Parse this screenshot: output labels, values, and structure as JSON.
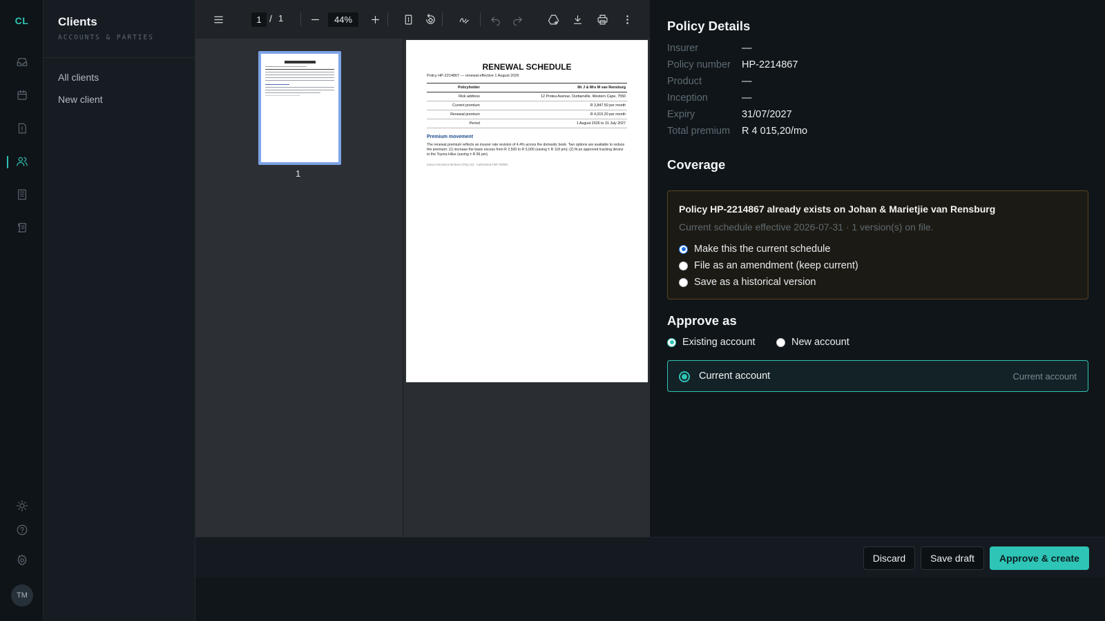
{
  "rail": {
    "logo": "CL",
    "icons": [
      "inbox-icon",
      "calendar-icon",
      "alert-doc-icon",
      "clients-icon",
      "building-icon",
      "ledger-icon"
    ],
    "bottom_icons": [
      "theme-icon",
      "help-icon",
      "settings-icon"
    ],
    "avatar": "TM",
    "accent": "#2ec4b6"
  },
  "subnav": {
    "title": "Clients",
    "subtitle": "ACCOUNTS & PARTIES",
    "items": [
      {
        "label": "All clients"
      },
      {
        "label": "New client"
      }
    ]
  },
  "viewer": {
    "current_page": "1",
    "page_separator": "/",
    "total_pages": "1",
    "zoom": "44%",
    "thumbnail_label": "1"
  },
  "document": {
    "title": "RENEWAL SCHEDULE",
    "subtitle": "Policy HP-2214867 — renewal effective 1 August 2026",
    "header_left": "Policyholder",
    "header_right": "Mr J & Mrs M van Rensburg",
    "rows": [
      {
        "label": "Risk address",
        "value": "12 Protea Avenue, Durbanville, Western Cape, 7550"
      },
      {
        "label": "Current premium",
        "value": "R 3,847.50 per month"
      },
      {
        "label": "Renewal premium",
        "value": "R 4,015.20 per month"
      },
      {
        "label": "Period",
        "value": "1 August 2026 to 31 July 2027"
      }
    ],
    "section_title": "Premium movement",
    "paragraph": "The renewal premium reflects an insurer rate revision of 4.4% across the domestic book. Two options are available to reduce the premium: (1) increase the basic excess from R 2,500 to R 5,000 (saving ± R 118 pm); (2) fit an approved tracking device to the Toyota Hilux (saving ± R 96 pm).",
    "footer": "Karoo Insurance Brokers (Pty) Ltd · Authorised FSP 00000"
  },
  "panel": {
    "policy_heading": "Policy Details",
    "details": [
      {
        "label": "Insurer",
        "value": "—"
      },
      {
        "label": "Policy number",
        "value": "HP-2214867"
      },
      {
        "label": "Product",
        "value": "—"
      },
      {
        "label": "Inception",
        "value": "—"
      },
      {
        "label": "Expiry",
        "value": "31/07/2027"
      },
      {
        "label": "Total premium",
        "value": "R 4 015,20/mo"
      }
    ],
    "coverage_heading": "Coverage",
    "conflict": {
      "title": "Policy HP-2214867 already exists on Johan & Marietjie van Rensburg",
      "subtitle": "Current schedule effective 2026-07-31 · 1 version(s) on file.",
      "options": [
        {
          "label": "Make this the current schedule",
          "selected": true
        },
        {
          "label": "File as an amendment (keep current)",
          "selected": false
        },
        {
          "label": "Save as a historical version",
          "selected": false
        }
      ],
      "border_color": "#5a4422"
    },
    "approve_heading": "Approve as",
    "account_types": [
      {
        "label": "Existing account",
        "selected": true
      },
      {
        "label": "New account",
        "selected": false
      }
    ],
    "selected_account": {
      "name": "Current account",
      "tag": "Current account"
    }
  },
  "footer": {
    "discard": "Discard",
    "save_draft": "Save draft",
    "approve": "Approve & create"
  }
}
